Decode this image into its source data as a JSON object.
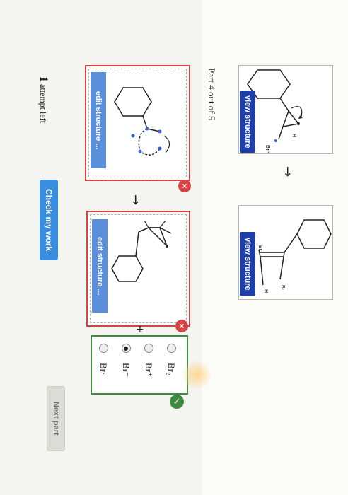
{
  "reaction": {
    "view_structure_label": "view structure",
    "reactant_labels": {
      "h": "H",
      "br_plus": "Br⁺"
    },
    "product_labels": {
      "br1": "Br",
      "br2": "Br",
      "h": "H"
    },
    "arrow": "→"
  },
  "part": {
    "label": "Part 4 out of 5"
  },
  "answers": {
    "edit_label": "edit structure ...",
    "remove_icon": "×",
    "plus": "+"
  },
  "choices": {
    "items": [
      {
        "label": "Br₂",
        "selected": false
      },
      {
        "label": "Br⁺",
        "selected": false
      },
      {
        "label": "Br⁻",
        "selected": true
      },
      {
        "label": "Br·",
        "selected": false
      }
    ],
    "status_icon": "✓"
  },
  "footer": {
    "attempt_count": "1",
    "attempt_text": "attempt left",
    "check_button": "Check my work",
    "next_button": "Next part"
  },
  "colors": {
    "blue_button": "#1f3fa8",
    "edit_bar": "#5b8fd9",
    "error_red": "#d84444",
    "success_green": "#3e8a3e"
  }
}
